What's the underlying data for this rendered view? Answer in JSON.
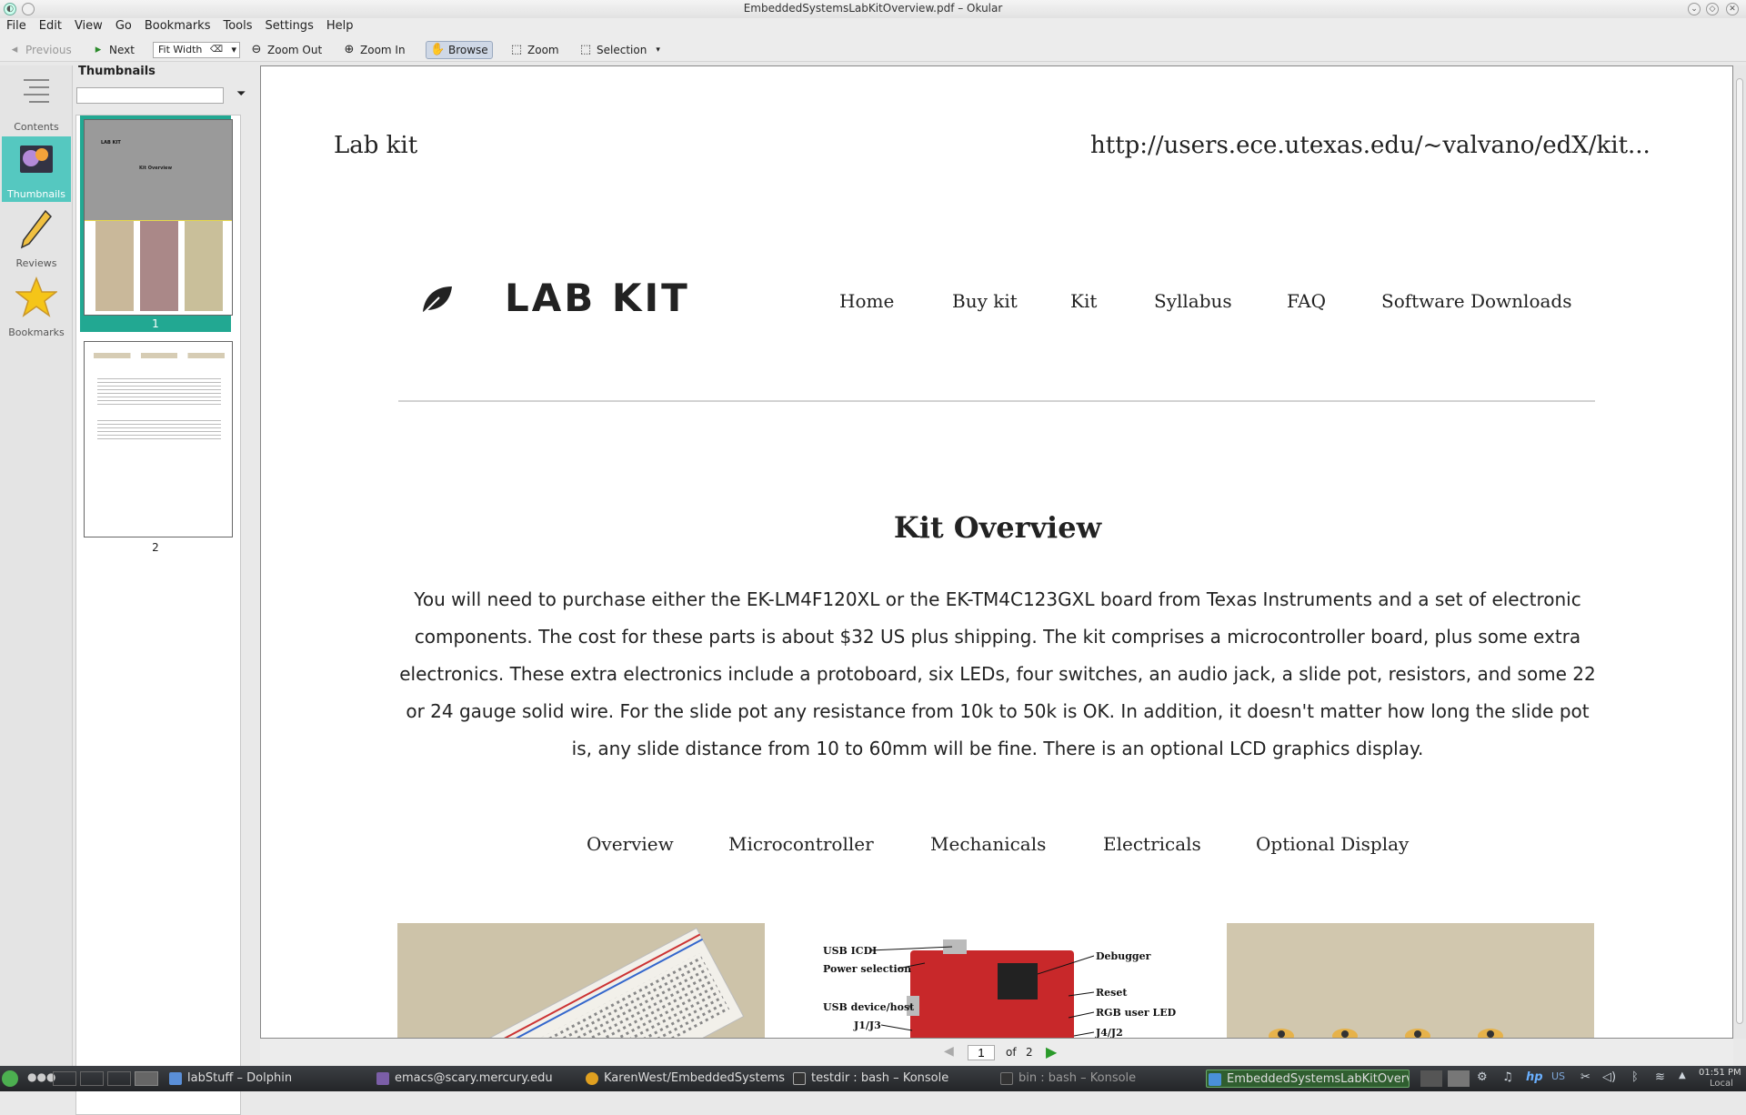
{
  "window": {
    "title": "EmbeddedSystemsLabKitOverview.pdf – Okular"
  },
  "menu": [
    "File",
    "Edit",
    "View",
    "Go",
    "Bookmarks",
    "Tools",
    "Settings",
    "Help"
  ],
  "toolbar": {
    "previous": "Previous",
    "next": "Next",
    "fit": "Fit Width",
    "zoom_out": "Zoom Out",
    "zoom_in": "Zoom In",
    "browse": "Browse",
    "zoom": "Zoom",
    "selection": "Selection"
  },
  "sidebar": {
    "items": [
      {
        "label": "Contents",
        "icon": "contents-icon",
        "active": false
      },
      {
        "label": "Thumbnails",
        "icon": "thumbnails-icon",
        "active": true
      },
      {
        "label": "Reviews",
        "icon": "pencil-icon",
        "active": false
      },
      {
        "label": "Bookmarks",
        "icon": "star-icon",
        "active": false
      }
    ]
  },
  "thumbnails": {
    "header": "Thumbnails",
    "search_placeholder": "",
    "pages": [
      "1",
      "2"
    ],
    "selected": "1"
  },
  "document": {
    "header_left": "Lab kit",
    "header_right": "http://users.ece.utexas.edu/~valvano/edX/kit...",
    "logo": "LAB KIT",
    "nav": [
      "Home",
      "Buy kit",
      "Kit",
      "Syllabus",
      "FAQ",
      "Software Downloads"
    ],
    "title": "Kit Overview",
    "intro": "You will need to purchase either the EK-LM4F120XL or the EK-TM4C123GXL board from Texas Instruments and a set of electronic components. The cost for these parts is about $32 US plus shipping. The kit comprises a microcontroller board, plus some extra electronics. These extra electronics include a protoboard, six LEDs, four switches, an audio jack, a slide pot, resistors, and some 22 or 24 gauge solid wire. For the slide pot any resistance from 10k to 50k is OK. In addition, it doesn't matter how long the slide pot is, any slide distance from 10 to 60mm will be fine. There is an optional LCD graphics display.",
    "subnav": [
      "Overview",
      "Microcontroller",
      "Mechanicals",
      "Electricals",
      "Optional Display"
    ],
    "board_labels": {
      "left": [
        "USB ICDI",
        "Power selection",
        "USB device/host",
        "J1/J3"
      ],
      "right": [
        "Debugger",
        "Reset",
        "RGB user LED",
        "J4/J2"
      ]
    }
  },
  "pagebar": {
    "current": "1",
    "of_label": "of",
    "total": "2"
  },
  "taskbar": {
    "tasks": [
      {
        "label": "labStuff – Dolphin",
        "active": false
      },
      {
        "label": "emacs@scary.mercury.edu",
        "active": false
      },
      {
        "label": "KarenWest/EmbeddedSystems",
        "active": false
      },
      {
        "label": "testdir : bash – Konsole",
        "active": false
      },
      {
        "label": "bin : bash – Konsole",
        "active": false
      },
      {
        "label": "EmbeddedSystemsLabKitOverv",
        "active": true
      }
    ],
    "tray": {
      "keyboard": "US",
      "time": "01:51 PM",
      "zone": "Local"
    }
  }
}
